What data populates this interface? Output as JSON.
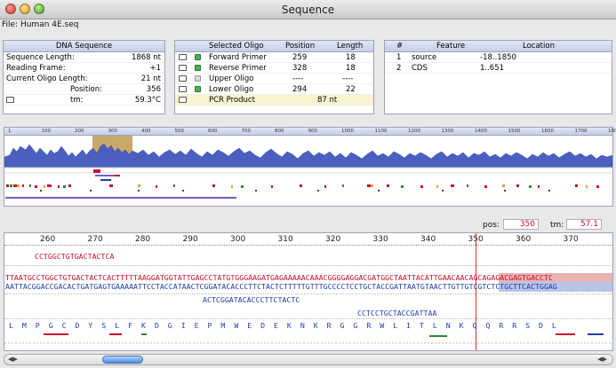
{
  "window": {
    "title": "Sequence"
  },
  "file_label": "File: Human 4E.seq",
  "dna_panel": {
    "header": "DNA Sequence",
    "rows": [
      {
        "label": "Sequence Length:",
        "value": "1868 nt"
      },
      {
        "label": "Reading Frame:",
        "value": "+1"
      },
      {
        "label": "Current Oligo Length:",
        "value": "21 nt"
      },
      {
        "label": "Position:",
        "value": "356"
      },
      {
        "label": "tm:",
        "value": "59.3°C"
      }
    ]
  },
  "oligo_panel": {
    "headers": [
      "Selected Oligo",
      "Position",
      "Length"
    ],
    "rows": [
      {
        "name": "Forward Primer",
        "position": "259",
        "length": "18",
        "checked": true
      },
      {
        "name": "Reverse Primer",
        "position": "328",
        "length": "18",
        "checked": true
      },
      {
        "name": "Upper Oligo",
        "position": "----",
        "length": "----",
        "checked": false
      },
      {
        "name": "Lower Oligo",
        "position": "294",
        "length": "22",
        "checked": true
      }
    ],
    "pcr": {
      "name": "PCR Product",
      "value": "87 nt"
    }
  },
  "feature_panel": {
    "headers": [
      "#",
      "Feature",
      "Location"
    ],
    "rows": [
      {
        "num": "1",
        "feature": "source",
        "location": "-18..1850"
      },
      {
        "num": "2",
        "feature": "CDS",
        "location": "1..651"
      }
    ]
  },
  "overview_ruler": [
    "1",
    "100",
    "200",
    "300",
    "400",
    "500",
    "600",
    "700",
    "800",
    "900",
    "1000",
    "1100",
    "1200",
    "1300",
    "1400",
    "1500",
    "1600",
    "1700",
    "1800"
  ],
  "pos_tm": {
    "pos_label": "pos:",
    "pos_value": "350",
    "tm_label": "tm:",
    "tm_value": "57.1"
  },
  "seq_ruler": [
    "260",
    "270",
    "280",
    "290",
    "300",
    "310",
    "320",
    "330",
    "340",
    "350",
    "360",
    "370"
  ],
  "sequence": {
    "primer_top": "CCTGGCTGTGACTACTCA",
    "top_strand": "TTAATGCCTGGCTGTGACTACTCACTTTTTAAGGATGGTATTGAGCCTATGTGGGAAGATGAGAAAAACAAACGGGGAGGACGATGGCTAATTACATTGAACAACAGCAGAGACGAGTGACCTC",
    "bottom_strand": "AATTACGGACCGACACTGATGAGTGAAAAATTCCTACCATAACTCGGATACACCCTTCTACTCTTTTTGTTTGCCCCTCCTGCTACCGATTAATGTAACTTGTTGTCGTCTCTGCTTCACTGGAG",
    "oligo_lower_1": "ACTCGGATACACCCTTCTACTC",
    "oligo_lower_2": "CCTCCTGCTACCGATTAA",
    "translation": "L  M  P  G  C  D  Y  S  L  F  K  D  G  I  E  P  M  W  E  D  E  K  N  K  R  G  G  R  W  L  I  T  L  N  K  Q  Q  R  R  S  D  L"
  },
  "colors": {
    "accent": "#3d6fb8",
    "plot": "#4a5fbf",
    "selection": "#c9a86a",
    "top_strand": "#c8102e",
    "bottom_strand": "#1f3fa8"
  }
}
